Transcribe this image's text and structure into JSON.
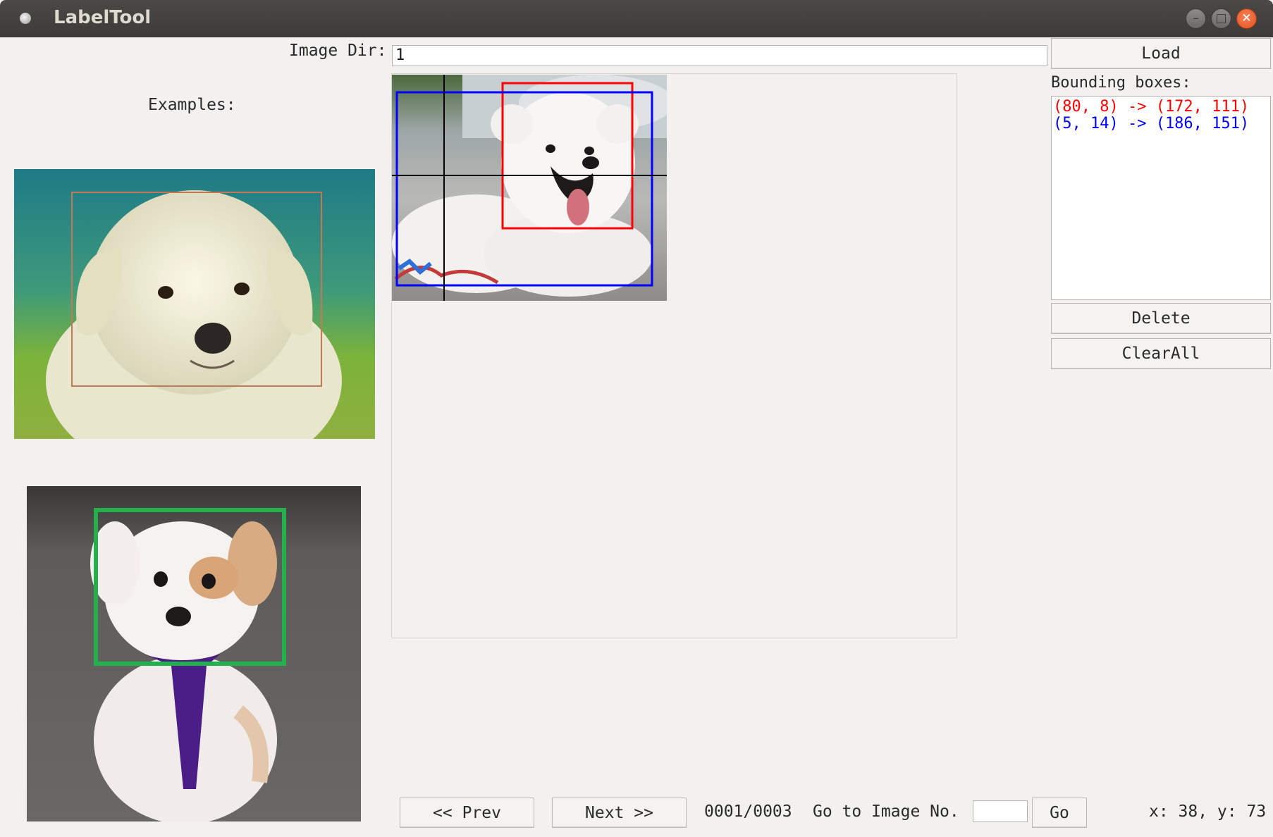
{
  "window": {
    "title": "LabelTool"
  },
  "top": {
    "image_dir_label": "Image Dir:",
    "image_dir_value": "1",
    "load_label": "Load"
  },
  "sidebar": {
    "bboxes_label": "Bounding boxes:",
    "bboxes": [
      {
        "text": "(80, 8) -> (172, 111)",
        "color": "#ff0000"
      },
      {
        "text": "(5, 14) -> (186, 151)",
        "color": "#0000ff"
      }
    ],
    "delete_label": "Delete",
    "clearall_label": "ClearAll"
  },
  "examples": {
    "label": "Examples:",
    "items": [
      "white-puppy-photo",
      "white-brown-puppy-photo"
    ],
    "box_colors": [
      "#c07a5a",
      "#22b14c"
    ]
  },
  "canvas": {
    "image": "samoyed-dog-photo",
    "box_colors": [
      "#ff0000",
      "#0000ff"
    ],
    "crosshair_color": "#000000"
  },
  "nav": {
    "prev_label": "<< Prev",
    "next_label": "Next >>",
    "progress": "0001/0003",
    "goto_label": "Go to Image No.",
    "goto_value": "",
    "go_label": "Go",
    "position": "x: 38, y: 73"
  }
}
